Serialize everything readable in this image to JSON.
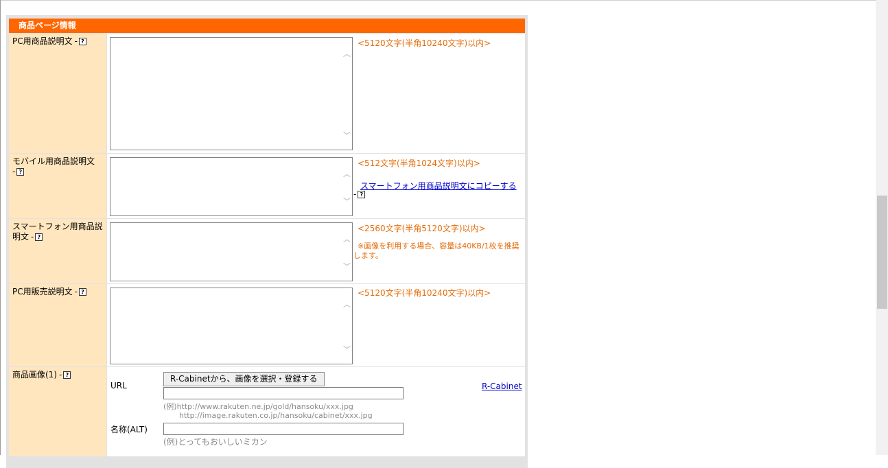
{
  "section": {
    "title": "商品ページ情報"
  },
  "help_icon_glyph": "?",
  "fields": {
    "pc_description": {
      "label": "PC用商品説明文",
      "limit": "<5120文字(半角10240文字)以内>"
    },
    "mobile_description": {
      "label": "モバイル用商品説明文",
      "limit": "<512文字(半角1024文字)以内>",
      "copy_link": "スマートフォン用商品説明文にコピーする"
    },
    "smartphone_description": {
      "label": "スマートフォン用商品説明文",
      "limit": "<2560文字(半角5120文字)以内>",
      "note": "※画像を利用する場合、容量は40KB/1枚を推奨します。"
    },
    "pc_sales_description": {
      "label": "PC用販売説明文",
      "limit": "<5120文字(半角10240文字)以内>"
    },
    "product_image": {
      "label": "商品画像(1)",
      "select_button": "R-Cabinetから、画像を選択・登録する",
      "url_label": "URL",
      "url_value": "",
      "url_example_line1": "(例)http://www.rakuten.ne.jp/gold/hansoku/xxx.jpg",
      "url_example_line2": "http://image.rakuten.co.jp/hansoku/cabinet/xxx.jpg",
      "alt_label": "名称(ALT)",
      "alt_value": "",
      "alt_example": "(例)とってもおいしいミカン",
      "cabinet_link": "R-Cabinet"
    }
  },
  "colors": {
    "header": "#ff6600",
    "label_bg": "#ffe6bf",
    "note": "#e46c0a",
    "link": "#0000cc"
  },
  "icons": [
    "help-icon",
    "scroll-up-icon",
    "scroll-down-icon"
  ]
}
